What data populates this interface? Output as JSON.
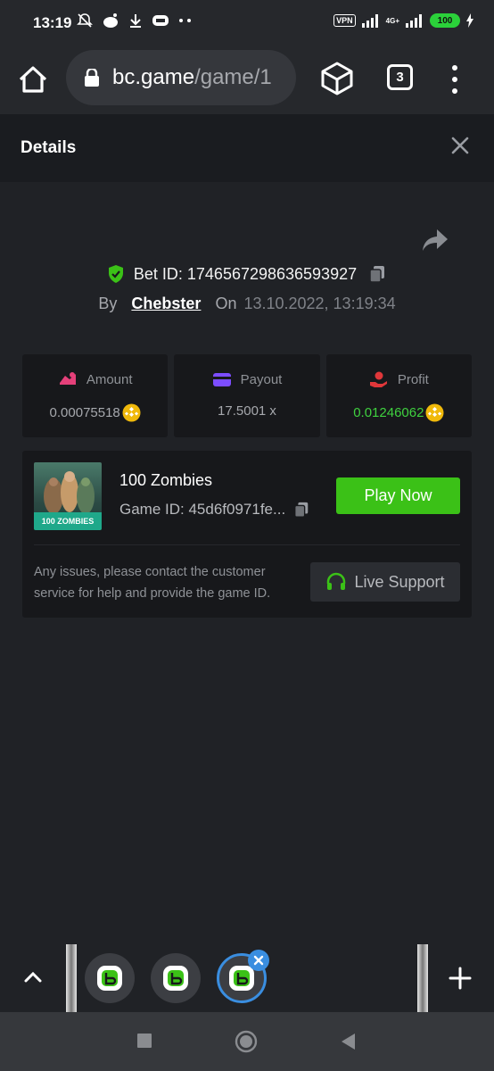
{
  "status_bar": {
    "time": "13:19",
    "vpn": "VPN",
    "network": "4G+",
    "battery": "100"
  },
  "browser": {
    "url_host": "bc.game",
    "url_path": "/game/1",
    "tab_count": "3"
  },
  "dialog": {
    "title": "Details"
  },
  "bet": {
    "id_text": "Bet ID: 1746567298636593927",
    "by_label": "By",
    "user": "Chebster",
    "on_label": "On",
    "date": "13.10.2022, 13:19:34"
  },
  "stats": [
    {
      "label": "Amount",
      "value": "0.00075518",
      "icon": "amount-icon",
      "color": "#e5407a"
    },
    {
      "label": "Payout",
      "value": "17.5001 x",
      "icon": "payout-card-icon",
      "color": "#7c4dff"
    },
    {
      "label": "Profit",
      "value": "0.01246062",
      "icon": "profit-icon",
      "color": "#e0373a"
    }
  ],
  "game": {
    "thumb_title": "100 ZOMBIES",
    "name": "100 Zombies",
    "id_text": "Game ID: 45d6f0971fe...",
    "play_label": "Play Now",
    "issues_text": "Any issues, please contact the customer service for help and provide the game ID.",
    "support_label": "Live Support"
  },
  "colors": {
    "accent_green": "#3bc117",
    "profit_green": "#3fd13f",
    "coin": "#f0b90b",
    "bubble_active": "#3a8ee0"
  }
}
